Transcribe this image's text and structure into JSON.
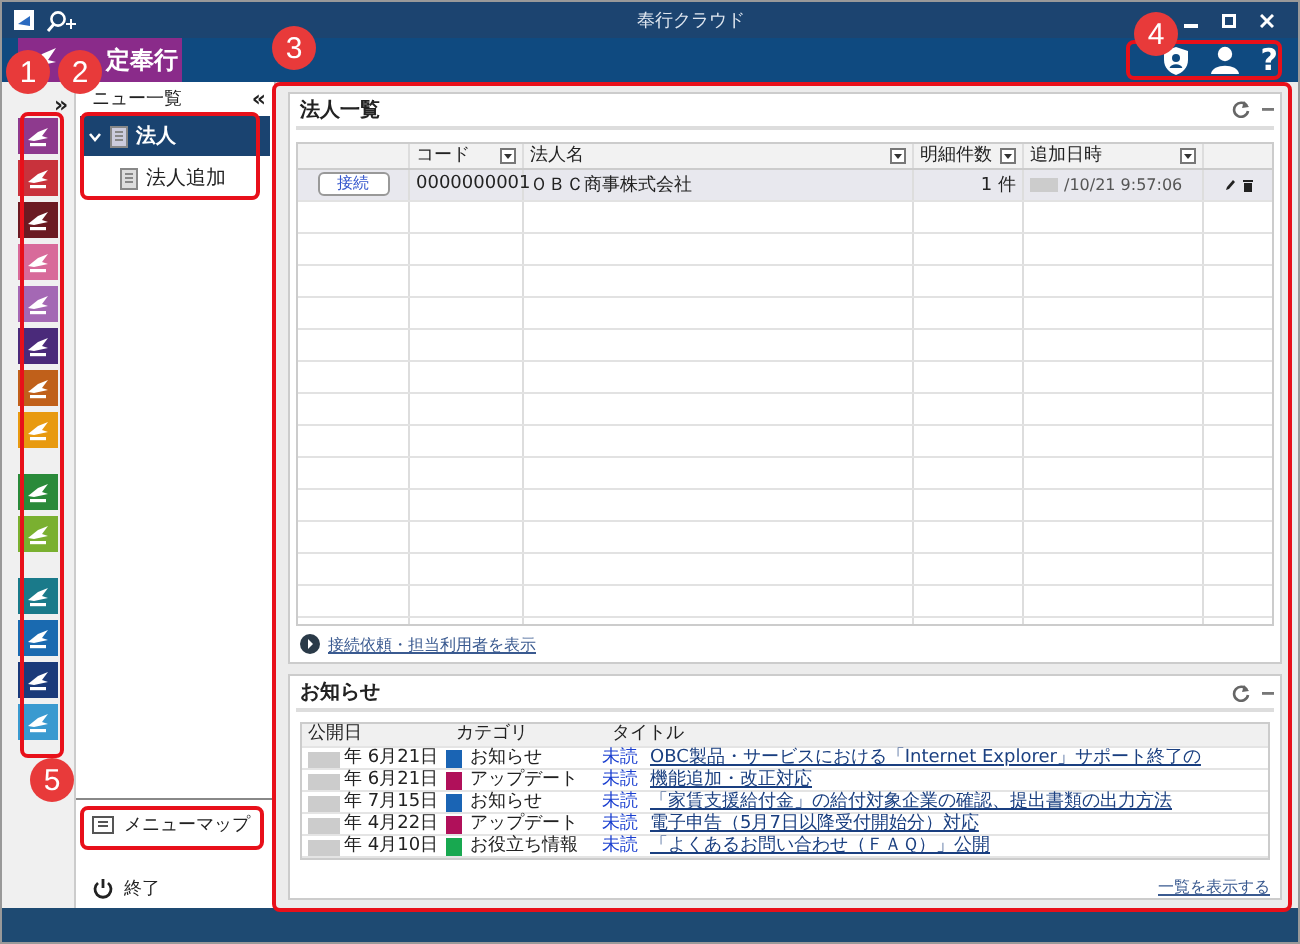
{
  "window": {
    "title": "奉行クラウド"
  },
  "header": {
    "product": "定奉行",
    "help": "?"
  },
  "product_strip": {
    "expand": "»",
    "tiles": [
      {
        "color": "#8e3a8e"
      },
      {
        "color": "#c8323c"
      },
      {
        "color": "#6b1a22"
      },
      {
        "color": "#d86a9a"
      },
      {
        "color": "#a468b4"
      },
      {
        "color": "#4a2a7a"
      },
      {
        "color": "#c0601a"
      },
      {
        "color": "#e89a10"
      },
      {
        "color": "#2a8a3a",
        "group_start": true
      },
      {
        "color": "#7ab030"
      },
      {
        "color": "#1a7a8a",
        "group_start": true
      },
      {
        "color": "#1a6ab0"
      },
      {
        "color": "#1a3a7a"
      },
      {
        "color": "#3a9ad0"
      }
    ]
  },
  "menu": {
    "title": "ニュー一覧",
    "collapse": "«",
    "items": [
      {
        "label": "法人",
        "expanded": true,
        "selected": true,
        "children": [
          {
            "label": "法人追加",
            "selected": false
          }
        ]
      }
    ],
    "footer": [
      {
        "label": "メニューマップ",
        "kind": "map"
      },
      {
        "label": "終了",
        "kind": "power"
      }
    ]
  },
  "corporations": {
    "title": "法人一覧",
    "columns": [
      "コード",
      "法人名",
      "明細件数",
      "追加日時"
    ],
    "rows": [
      {
        "action": "接続",
        "code": "0000000001",
        "name": "ＯＢＣ商事株式会社",
        "count": "1 件",
        "added": "/10/21 9:57:06",
        "selected": true
      }
    ],
    "link": "接続依頼・担当利用者を表示"
  },
  "notices": {
    "title": "お知らせ",
    "columns": [
      "公開日",
      "カテゴリ",
      "タイトル"
    ],
    "rows": [
      {
        "date": "年 6月21日",
        "category": "お知らせ",
        "color": "#1a64b4",
        "status": "未読",
        "title": "OBC製品・サービスにおける「Internet Explorer」サポート終了の"
      },
      {
        "date": "年 6月21日",
        "category": "アップデート",
        "color": "#b0105a",
        "status": "未読",
        "title": "機能追加・改正対応"
      },
      {
        "date": "年 7月15日",
        "category": "お知らせ",
        "color": "#1a64b4",
        "status": "未読",
        "title": "「家賃支援給付金」の給付対象企業の確認、提出書類の出力方法"
      },
      {
        "date": "年 4月22日",
        "category": "アップデート",
        "color": "#b0105a",
        "status": "未読",
        "title": "電子申告（5月7日以降受付開始分）対応"
      },
      {
        "date": "年 4月10日",
        "category": "お役立ち情報",
        "color": "#18a850",
        "status": "未読",
        "title": "「よくあるお問い合わせ（ＦＡＱ）」公開"
      }
    ],
    "more": "一覧を表示する"
  },
  "callouts": [
    {
      "number": "1"
    },
    {
      "number": "2"
    },
    {
      "number": "3"
    },
    {
      "number": "4"
    },
    {
      "number": "5"
    }
  ]
}
